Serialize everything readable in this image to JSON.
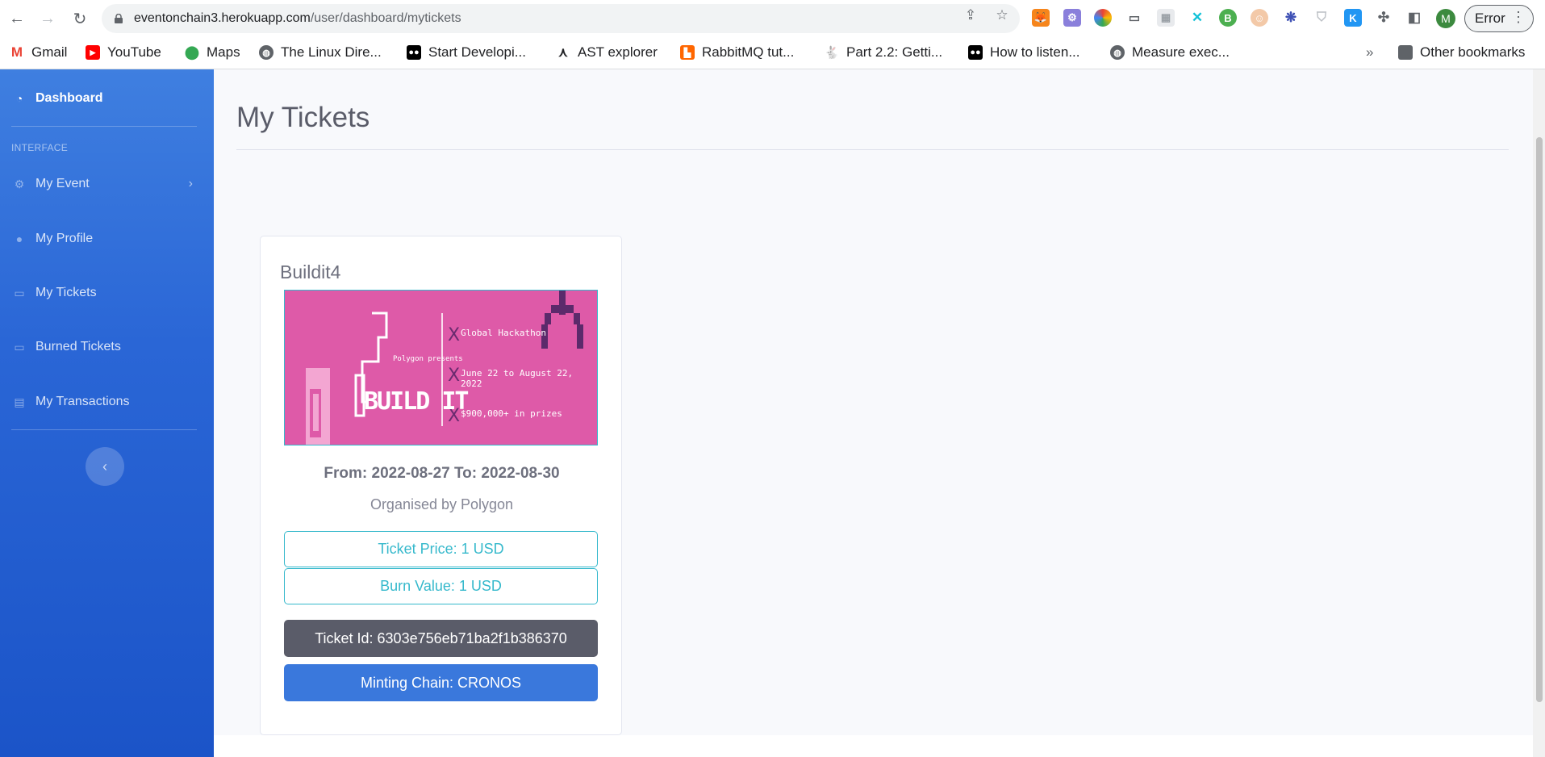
{
  "browser": {
    "url_host": "eventonchain3.herokuapp.com",
    "url_path": "/user/dashboard/mytickets",
    "profile_initial": "M",
    "error_label": "Error",
    "other_bookmarks": "Other bookmarks",
    "overflow": "»"
  },
  "bookmarks": [
    {
      "label": "Gmail",
      "icon": "gmail-icon",
      "color": "#ea4335"
    },
    {
      "label": "YouTube",
      "icon": "youtube-icon",
      "color": "#ff0000"
    },
    {
      "label": "Maps",
      "icon": "maps-icon",
      "color": "#34a853"
    },
    {
      "label": "The Linux Dire...",
      "icon": "globe-icon",
      "color": "#5f6368"
    },
    {
      "label": "Start Developi...",
      "icon": "medium-icon",
      "color": "#000000"
    },
    {
      "label": "AST explorer",
      "icon": "ast-icon",
      "color": "#202124"
    },
    {
      "label": "RabbitMQ tut...",
      "icon": "rabbitmq-icon",
      "color": "#ff6600"
    },
    {
      "label": "Part 2.2: Getti...",
      "icon": "rabbit-icon",
      "color": "#8a8a8a"
    },
    {
      "label": "How to listen...",
      "icon": "medium-icon",
      "color": "#000000"
    },
    {
      "label": "Measure exec...",
      "icon": "globe-icon",
      "color": "#5f6368"
    }
  ],
  "sidebar": {
    "dashboard": "Dashboard",
    "heading": "INTERFACE",
    "items": [
      {
        "label": "My Event",
        "icon": "cog-icon"
      },
      {
        "label": "My Profile",
        "icon": "user-icon"
      },
      {
        "label": "My Tickets",
        "icon": "ticket-icon"
      },
      {
        "label": "Burned Tickets",
        "icon": "ticket-icon"
      },
      {
        "label": "My Transactions",
        "icon": "receipt-icon"
      }
    ]
  },
  "page": {
    "title": "My Tickets"
  },
  "ticket": {
    "event_name": "Buildit4",
    "dates": "From: 2022-08-27 To: 2022-08-30",
    "organiser": "Organised by Polygon",
    "price": "Ticket Price: 1 USD",
    "burn_value": "Burn Value: 1 USD",
    "ticket_id": "Ticket Id: 6303e756eb71ba2f1b386370",
    "minting_chain": "Minting Chain: CRONOS",
    "banner": {
      "line1": "Global Hackathon",
      "line2": "June 22 to August 22, 2022",
      "line3": "$900,000+ in prizes",
      "logo_sub": "Polygon presents",
      "logo_main": "BUILD IT",
      "bg_color": "#de5aa8"
    }
  },
  "colors": {
    "sidebar": "#2a66d6",
    "accent_info": "#36b9cc",
    "dark_button": "#5a5c69",
    "primary_button": "#3a78dc"
  }
}
